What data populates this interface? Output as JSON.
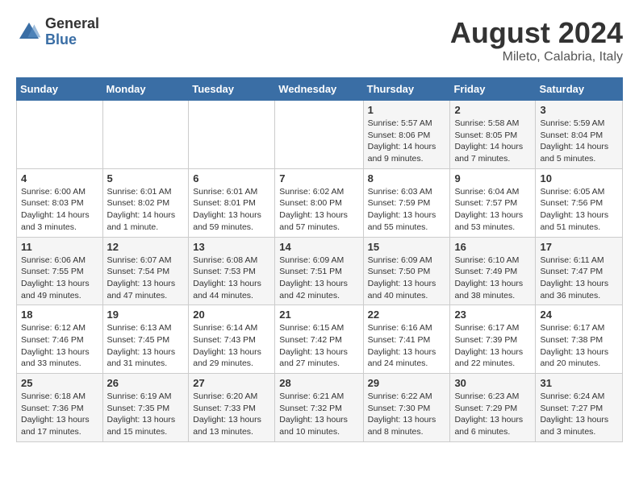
{
  "header": {
    "logo_general": "General",
    "logo_blue": "Blue",
    "title": "August 2024",
    "location": "Mileto, Calabria, Italy"
  },
  "days_of_week": [
    "Sunday",
    "Monday",
    "Tuesday",
    "Wednesday",
    "Thursday",
    "Friday",
    "Saturday"
  ],
  "weeks": [
    [
      {
        "day": "",
        "info": ""
      },
      {
        "day": "",
        "info": ""
      },
      {
        "day": "",
        "info": ""
      },
      {
        "day": "",
        "info": ""
      },
      {
        "day": "1",
        "info": "Sunrise: 5:57 AM\nSunset: 8:06 PM\nDaylight: 14 hours\nand 9 minutes."
      },
      {
        "day": "2",
        "info": "Sunrise: 5:58 AM\nSunset: 8:05 PM\nDaylight: 14 hours\nand 7 minutes."
      },
      {
        "day": "3",
        "info": "Sunrise: 5:59 AM\nSunset: 8:04 PM\nDaylight: 14 hours\nand 5 minutes."
      }
    ],
    [
      {
        "day": "4",
        "info": "Sunrise: 6:00 AM\nSunset: 8:03 PM\nDaylight: 14 hours\nand 3 minutes."
      },
      {
        "day": "5",
        "info": "Sunrise: 6:01 AM\nSunset: 8:02 PM\nDaylight: 14 hours\nand 1 minute."
      },
      {
        "day": "6",
        "info": "Sunrise: 6:01 AM\nSunset: 8:01 PM\nDaylight: 13 hours\nand 59 minutes."
      },
      {
        "day": "7",
        "info": "Sunrise: 6:02 AM\nSunset: 8:00 PM\nDaylight: 13 hours\nand 57 minutes."
      },
      {
        "day": "8",
        "info": "Sunrise: 6:03 AM\nSunset: 7:59 PM\nDaylight: 13 hours\nand 55 minutes."
      },
      {
        "day": "9",
        "info": "Sunrise: 6:04 AM\nSunset: 7:57 PM\nDaylight: 13 hours\nand 53 minutes."
      },
      {
        "day": "10",
        "info": "Sunrise: 6:05 AM\nSunset: 7:56 PM\nDaylight: 13 hours\nand 51 minutes."
      }
    ],
    [
      {
        "day": "11",
        "info": "Sunrise: 6:06 AM\nSunset: 7:55 PM\nDaylight: 13 hours\nand 49 minutes."
      },
      {
        "day": "12",
        "info": "Sunrise: 6:07 AM\nSunset: 7:54 PM\nDaylight: 13 hours\nand 47 minutes."
      },
      {
        "day": "13",
        "info": "Sunrise: 6:08 AM\nSunset: 7:53 PM\nDaylight: 13 hours\nand 44 minutes."
      },
      {
        "day": "14",
        "info": "Sunrise: 6:09 AM\nSunset: 7:51 PM\nDaylight: 13 hours\nand 42 minutes."
      },
      {
        "day": "15",
        "info": "Sunrise: 6:09 AM\nSunset: 7:50 PM\nDaylight: 13 hours\nand 40 minutes."
      },
      {
        "day": "16",
        "info": "Sunrise: 6:10 AM\nSunset: 7:49 PM\nDaylight: 13 hours\nand 38 minutes."
      },
      {
        "day": "17",
        "info": "Sunrise: 6:11 AM\nSunset: 7:47 PM\nDaylight: 13 hours\nand 36 minutes."
      }
    ],
    [
      {
        "day": "18",
        "info": "Sunrise: 6:12 AM\nSunset: 7:46 PM\nDaylight: 13 hours\nand 33 minutes."
      },
      {
        "day": "19",
        "info": "Sunrise: 6:13 AM\nSunset: 7:45 PM\nDaylight: 13 hours\nand 31 minutes."
      },
      {
        "day": "20",
        "info": "Sunrise: 6:14 AM\nSunset: 7:43 PM\nDaylight: 13 hours\nand 29 minutes."
      },
      {
        "day": "21",
        "info": "Sunrise: 6:15 AM\nSunset: 7:42 PM\nDaylight: 13 hours\nand 27 minutes."
      },
      {
        "day": "22",
        "info": "Sunrise: 6:16 AM\nSunset: 7:41 PM\nDaylight: 13 hours\nand 24 minutes."
      },
      {
        "day": "23",
        "info": "Sunrise: 6:17 AM\nSunset: 7:39 PM\nDaylight: 13 hours\nand 22 minutes."
      },
      {
        "day": "24",
        "info": "Sunrise: 6:17 AM\nSunset: 7:38 PM\nDaylight: 13 hours\nand 20 minutes."
      }
    ],
    [
      {
        "day": "25",
        "info": "Sunrise: 6:18 AM\nSunset: 7:36 PM\nDaylight: 13 hours\nand 17 minutes."
      },
      {
        "day": "26",
        "info": "Sunrise: 6:19 AM\nSunset: 7:35 PM\nDaylight: 13 hours\nand 15 minutes."
      },
      {
        "day": "27",
        "info": "Sunrise: 6:20 AM\nSunset: 7:33 PM\nDaylight: 13 hours\nand 13 minutes."
      },
      {
        "day": "28",
        "info": "Sunrise: 6:21 AM\nSunset: 7:32 PM\nDaylight: 13 hours\nand 10 minutes."
      },
      {
        "day": "29",
        "info": "Sunrise: 6:22 AM\nSunset: 7:30 PM\nDaylight: 13 hours\nand 8 minutes."
      },
      {
        "day": "30",
        "info": "Sunrise: 6:23 AM\nSunset: 7:29 PM\nDaylight: 13 hours\nand 6 minutes."
      },
      {
        "day": "31",
        "info": "Sunrise: 6:24 AM\nSunset: 7:27 PM\nDaylight: 13 hours\nand 3 minutes."
      }
    ]
  ]
}
